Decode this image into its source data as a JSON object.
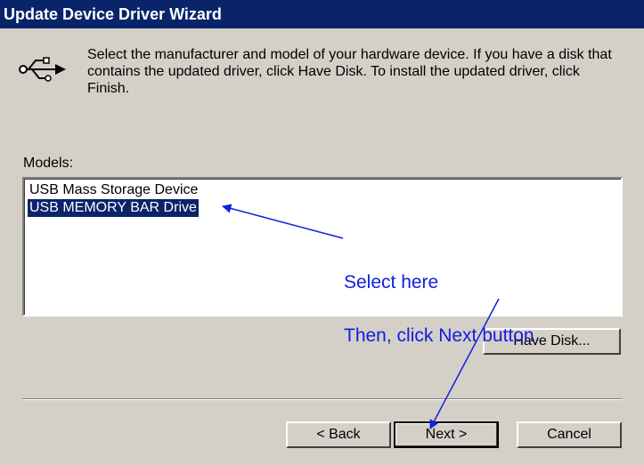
{
  "window": {
    "title": "Update Device Driver Wizard"
  },
  "description": "Select the manufacturer and model of your hardware device. If you have a disk that contains the updated driver, click Have Disk. To install the updated driver, click Finish.",
  "models": {
    "label": "Models:",
    "items": [
      "USB Mass Storage Device",
      "USB MEMORY BAR Drive"
    ],
    "selected_index": 1
  },
  "buttons": {
    "have_disk": "Have Disk...",
    "back": "< Back",
    "next": "Next >",
    "cancel": "Cancel"
  },
  "annotation": {
    "line1": "Select here",
    "line2": "Then, click Next button",
    "color": "#1020e0"
  },
  "icons": {
    "device": "usb-icon"
  }
}
